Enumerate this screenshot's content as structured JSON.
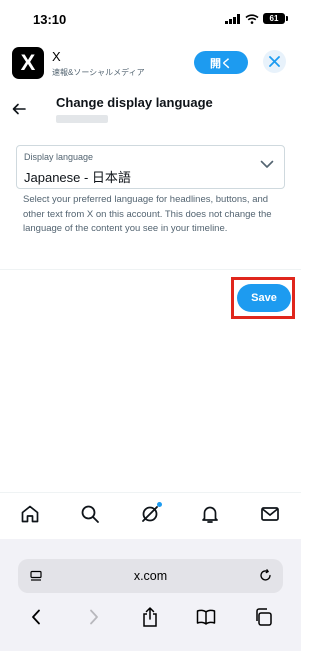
{
  "status": {
    "time": "13:10",
    "battery": "61"
  },
  "banner": {
    "logo": "X",
    "app_name": "X",
    "subtitle": "速報&ソーシャルメディア",
    "open_label": "開く"
  },
  "header": {
    "title": "Change display language"
  },
  "form": {
    "select_label": "Display language",
    "select_value": "Japanese - 日本語",
    "help_text": "Select your preferred language for headlines, buttons, and other text from X on this account. This does not change the language of the content you see in your timeline."
  },
  "actions": {
    "save_label": "Save"
  },
  "browser": {
    "url": "x.com"
  },
  "colors": {
    "accent": "#1d9bf0",
    "highlight": "#e0261c"
  }
}
